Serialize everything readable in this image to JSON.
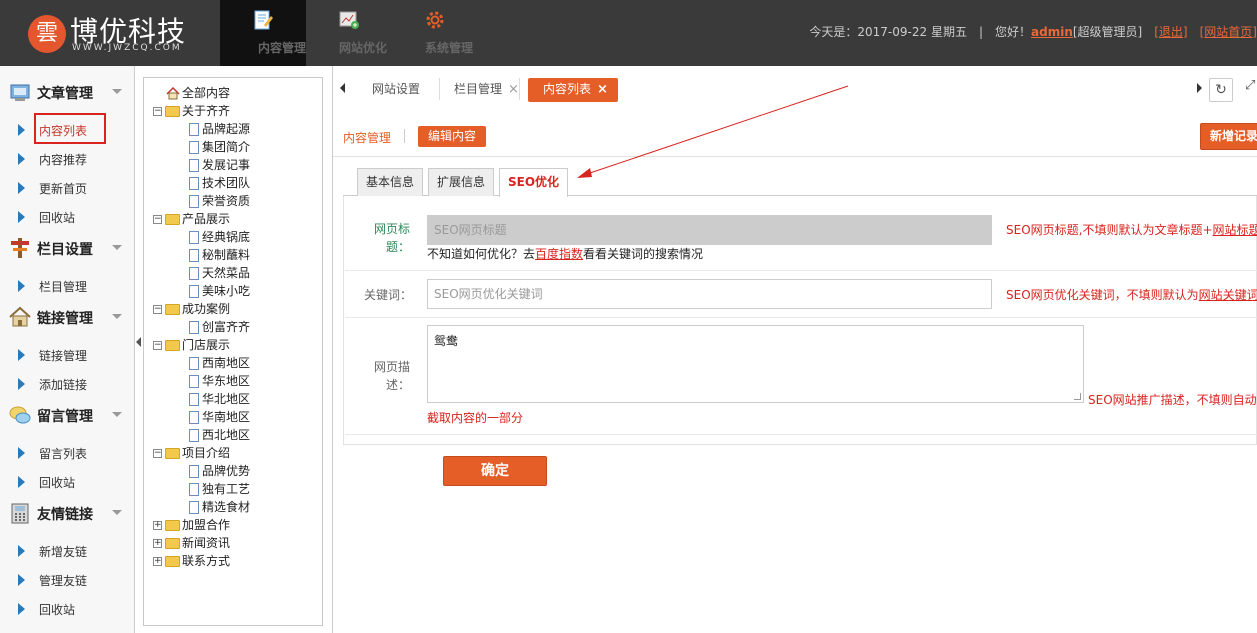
{
  "header": {
    "logo_mark": "雲",
    "logo_name": "博优科技",
    "logo_url": "WWW.JWZCQ.COM",
    "nav": [
      {
        "label": "内容管理",
        "icon": "edit-document-icon"
      },
      {
        "label": "网站优化",
        "icon": "web-optimize-icon"
      },
      {
        "label": "系统管理",
        "icon": "gear-icon"
      }
    ],
    "date_text": "今天是：2017-09-22 星期五",
    "sep": "|",
    "greeting": "您好！",
    "username": "admin",
    "role": "[超级管理员]",
    "logout": "[退出]",
    "site_home": "[网站首页]"
  },
  "sidebar": {
    "groups": [
      {
        "title": "文章管理",
        "icon": "article-icon",
        "items": [
          "内容列表",
          "内容推荐",
          "更新首页",
          "回收站"
        ]
      },
      {
        "title": "栏目设置",
        "icon": "column-settings-icon",
        "items": [
          "栏目管理"
        ]
      },
      {
        "title": "链接管理",
        "icon": "link-house-icon",
        "items": [
          "链接管理",
          "添加链接"
        ]
      },
      {
        "title": "留言管理",
        "icon": "message-bubble-icon",
        "items": [
          "留言列表",
          "回收站"
        ]
      },
      {
        "title": "友情链接",
        "icon": "phone-icon",
        "items": [
          "新增友链",
          "管理友链",
          "回收站"
        ]
      }
    ],
    "active_item": "内容列表"
  },
  "tree": {
    "root": "全部内容",
    "nodes": [
      {
        "label": "关于齐齐",
        "children": [
          "品牌起源",
          "集团简介",
          "发展记事",
          "技术团队",
          "荣誉资质"
        ]
      },
      {
        "label": "产品展示",
        "children": [
          "经典锅底",
          "秘制蘸料",
          "天然菜品",
          "美味小吃"
        ]
      },
      {
        "label": "成功案例",
        "children": [
          "创富齐齐"
        ]
      },
      {
        "label": "门店展示",
        "children": [
          "西南地区",
          "华东地区",
          "华北地区",
          "华南地区",
          "西北地区"
        ]
      },
      {
        "label": "项目介绍",
        "children": [
          "品牌优势",
          "独有工艺",
          "精选食材"
        ]
      },
      {
        "label": "加盟合作",
        "children": []
      },
      {
        "label": "新闻资讯",
        "children": []
      },
      {
        "label": "联系方式",
        "children": []
      }
    ]
  },
  "tabs": {
    "items": [
      {
        "label": "网站设置",
        "closable": false
      },
      {
        "label": "栏目管理",
        "closable": true
      },
      {
        "label": "内容列表",
        "closable": true
      }
    ],
    "close_glyph": "×"
  },
  "main": {
    "crumb_section": "内容管理",
    "crumb_current": "编辑内容",
    "add_button": "新增记录",
    "subtabs": [
      "基本信息",
      "扩展信息",
      "SEO优化"
    ],
    "active_subtab": "SEO优化",
    "form": {
      "title_label": "网页标题：",
      "title_placeholder": "SEO网页标题",
      "title_tip_prefix": "SEO网页标题,不填则默认为文章标题+",
      "title_tip_link": "网站标题",
      "howto_prefix": "不知道如何优化？去",
      "howto_link": "百度指数",
      "howto_suffix": "看看关键词的搜索情况",
      "keywords_label": "关键词：",
      "keywords_placeholder": "SEO网页优化关键词",
      "keywords_tip_prefix": "SEO网页优化关键词，不填则默认为",
      "keywords_tip_link": "网站关键词",
      "desc_label": "网页描述：",
      "desc_value": "鸳鸯",
      "desc_tip": "SEO网站推广描述，不填则自动",
      "desc_note": "截取内容的一部分",
      "submit": "确定"
    }
  },
  "colors": {
    "accent": "#e55d27",
    "topbar": "#3a3a3a",
    "danger": "#d9231e",
    "label_green": "#2b8a57"
  }
}
